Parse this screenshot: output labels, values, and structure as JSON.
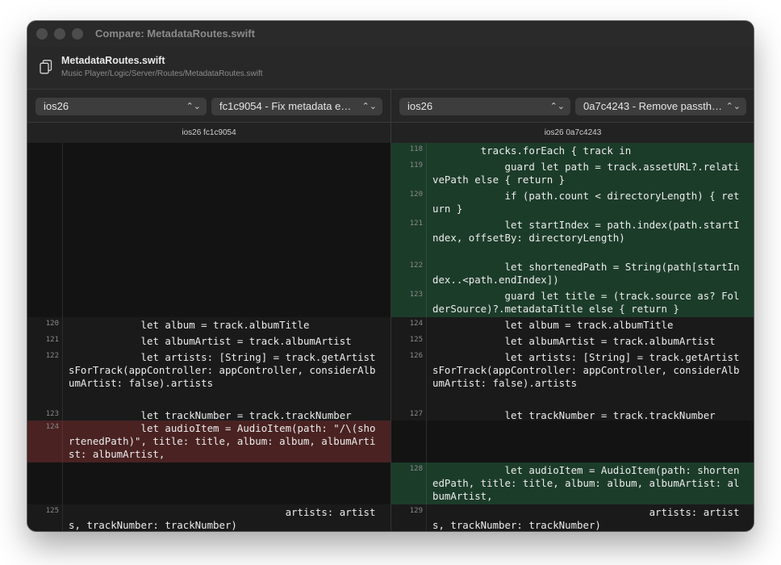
{
  "window": {
    "title": "Compare: MetadataRoutes.swift"
  },
  "file": {
    "icon": "file-copies-icon",
    "name": "MetadataRoutes.swift",
    "path": "Music Player/Logic/Server/Routes/MetadataRoutes.swift"
  },
  "pickers": {
    "left_branch": "ios26",
    "left_commit": "fc1c9054 - Fix metadata e…",
    "right_branch": "ios26",
    "right_commit": "0a7c4243 - Remove passth…",
    "chevron": "⌃⌄"
  },
  "columns": {
    "left": "ios26 fc1c9054",
    "right": "ios26 0a7c4243"
  },
  "colors": {
    "added": "#1c3c2a",
    "removed": "#4a2222",
    "context": "#1a1a1a"
  },
  "left_lines": [
    {
      "num": "",
      "kind": "blank",
      "text": ""
    },
    {
      "num": "120",
      "kind": "ctx",
      "text": "            let album = track.albumTitle"
    },
    {
      "num": "121",
      "kind": "ctx",
      "text": "            let albumArtist = track.albumArtist"
    },
    {
      "num": "122",
      "kind": "ctx",
      "text": "            let artists: [String] = track.getArtistsForTrack(appController: appController, considerAlbumArtist: false).artists"
    },
    {
      "num": "123",
      "kind": "ctx",
      "text": "            let trackNumber = track.trackNumber"
    },
    {
      "num": "124",
      "kind": "del",
      "text": "            let audioItem = AudioItem(path: \"/\\(shortenedPath)\", title: title, album: album, albumArtist: albumArtist,"
    },
    {
      "num": "",
      "kind": "blank",
      "text": ""
    },
    {
      "num": "125",
      "kind": "ctx",
      "text": "                                    artists: artists, trackNumber: trackNumber)"
    }
  ],
  "right_lines": [
    {
      "num": "118",
      "kind": "add",
      "text": "        tracks.forEach { track in"
    },
    {
      "num": "119",
      "kind": "add",
      "text": "            guard let path = track.assetURL?.relativePath else { return }"
    },
    {
      "num": "120",
      "kind": "add",
      "text": "            if (path.count < directoryLength) { return }"
    },
    {
      "num": "121",
      "kind": "add",
      "text": "            let startIndex = path.index(path.startIndex, offsetBy: directoryLength)"
    },
    {
      "num": "122",
      "kind": "add",
      "text": "            let shortenedPath = String(path[startIndex..<path.endIndex])"
    },
    {
      "num": "123",
      "kind": "add",
      "text": "            guard let title = (track.source as? FolderSource)?.metadataTitle else { return }"
    },
    {
      "num": "124",
      "kind": "ctx",
      "text": "            let album = track.albumTitle"
    },
    {
      "num": "125",
      "kind": "ctx",
      "text": "            let albumArtist = track.albumArtist"
    },
    {
      "num": "126",
      "kind": "ctx",
      "text": "            let artists: [String] = track.getArtistsForTrack(appController: appController, considerAlbumArtist: false).artists"
    },
    {
      "num": "127",
      "kind": "ctx",
      "text": "            let trackNumber = track.trackNumber"
    },
    {
      "num": "",
      "kind": "blank",
      "text": ""
    },
    {
      "num": "128",
      "kind": "add",
      "text": "            let audioItem = AudioItem(path: shortenedPath, title: title, album: album, albumArtist: albumArtist,"
    },
    {
      "num": "129",
      "kind": "ctx",
      "text": "                                    artists: artists, trackNumber: trackNumber)"
    }
  ]
}
